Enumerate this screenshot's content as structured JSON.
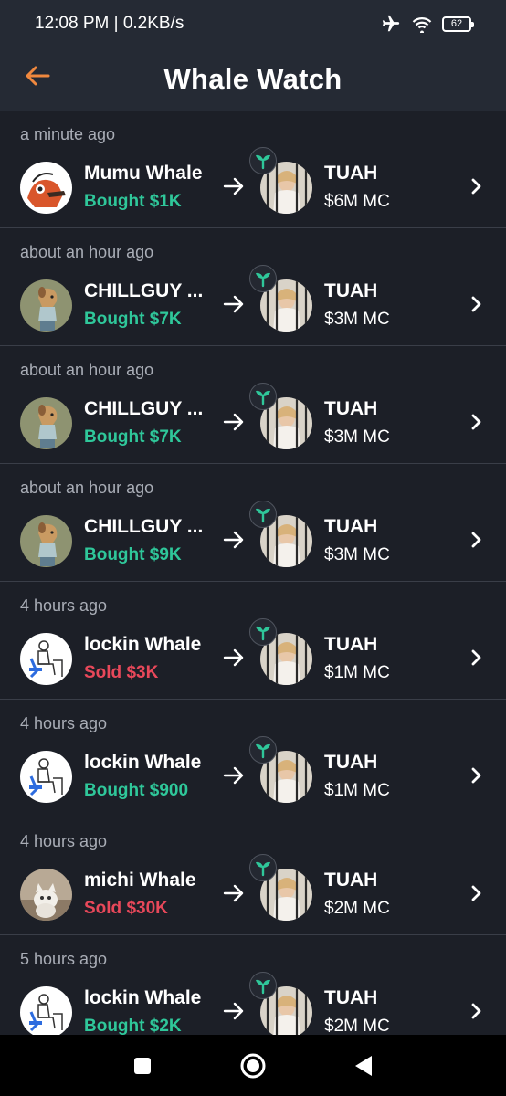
{
  "status_bar": {
    "time_speed": "12:08 PM | 0.2KB/s",
    "battery": "62"
  },
  "header": {
    "title": "Whale Watch",
    "back_icon": "back-arrow-icon",
    "accent": "#f0883e"
  },
  "colors": {
    "buy": "#2fc79a",
    "sell": "#e8485a",
    "background": "#1c1f27",
    "header": "#252a34"
  },
  "feed": [
    {
      "time": "a minute ago",
      "whale": "Mumu Whale",
      "avatar": "mumu",
      "trade": "Bought $1K",
      "side": "buy",
      "token": "TUAH",
      "mc": "$6M MC"
    },
    {
      "time": "about an hour ago",
      "whale": "CHILLGUY ...",
      "avatar": "chillguy",
      "trade": "Bought $7K",
      "side": "buy",
      "token": "TUAH",
      "mc": "$3M MC"
    },
    {
      "time": "about an hour ago",
      "whale": "CHILLGUY ...",
      "avatar": "chillguy",
      "trade": "Bought $7K",
      "side": "buy",
      "token": "TUAH",
      "mc": "$3M MC"
    },
    {
      "time": "about an hour ago",
      "whale": "CHILLGUY ...",
      "avatar": "chillguy",
      "trade": "Bought $9K",
      "side": "buy",
      "token": "TUAH",
      "mc": "$3M MC"
    },
    {
      "time": "4 hours ago",
      "whale": "lockin Whale",
      "avatar": "lockin",
      "trade": "Sold $3K",
      "side": "sell",
      "token": "TUAH",
      "mc": "$1M MC"
    },
    {
      "time": "4 hours ago",
      "whale": "lockin Whale",
      "avatar": "lockin",
      "trade": "Bought $900",
      "side": "buy",
      "token": "TUAH",
      "mc": "$1M MC"
    },
    {
      "time": "4 hours ago",
      "whale": "michi Whale",
      "avatar": "michi",
      "trade": "Sold $30K",
      "side": "sell",
      "token": "TUAH",
      "mc": "$2M MC"
    },
    {
      "time": "5 hours ago",
      "whale": "lockin Whale",
      "avatar": "lockin",
      "trade": "Bought $2K",
      "side": "buy",
      "token": "TUAH",
      "mc": "$2M MC"
    }
  ],
  "nav": {
    "items": [
      "recents-square-icon",
      "home-circle-icon",
      "back-triangle-icon"
    ]
  }
}
